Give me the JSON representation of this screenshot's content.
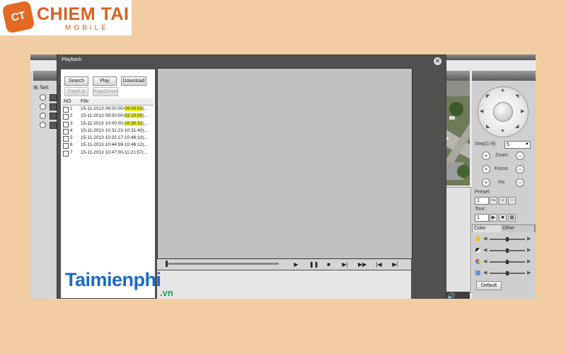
{
  "brand": {
    "badge": "CT",
    "name": "CHIEM TAI",
    "sub": "MOBILE"
  },
  "sidebar": {
    "net_label": "Net"
  },
  "dialog": {
    "title": "Playback",
    "buttons": {
      "search": "Search",
      "play": "Play",
      "download": "Download",
      "page_up": "PageUp",
      "page_down": "PageDown"
    },
    "columns": {
      "no": "NO",
      "file": "File"
    },
    "rows": [
      {
        "no": "1",
        "file": "15-11-2013 08:00:00-09:00:03(..."
      },
      {
        "no": "2",
        "file": "15-11-2013 09:00:00-02:10:00(..."
      },
      {
        "no": "3",
        "file": "15-11-2013 10:00:00-10:30:31(..."
      },
      {
        "no": "4",
        "file": "15-11-2013 10:31:21-10:31:40(..."
      },
      {
        "no": "5",
        "file": "15-11-2013 10:32:27-10:46:10(..."
      },
      {
        "no": "6",
        "file": "15-11-2013 10:44:59-10:46:12(..."
      },
      {
        "no": "7",
        "file": "15-11-2013 10:47:00-11:21:57(..."
      }
    ],
    "controls": [
      "play-icon",
      "pause-icon",
      "stop-icon",
      "step-icon",
      "fast-forward-icon",
      "prev-frame-icon",
      "next-frame-icon"
    ]
  },
  "ptz": {
    "step_label": "Step(1-8):",
    "step_value": "5",
    "zoom": "Zoom",
    "focus": "Focus",
    "iris": "Iris",
    "preset_label": "Preset:",
    "preset_value": "1",
    "tour_label": "Tour:",
    "tour_value": "1",
    "tabs": {
      "color": "Color",
      "other": "Other"
    },
    "default_button": "Default"
  },
  "watermark": {
    "text": "Taimienphi",
    "suffix": ".vn"
  },
  "colors": {
    "background": "#f2cda4",
    "brand_orange": "#d9601e",
    "highlight": "#f1f51f",
    "watermark_blue": "#1b6bc6",
    "watermark_green": "#17a25b"
  }
}
